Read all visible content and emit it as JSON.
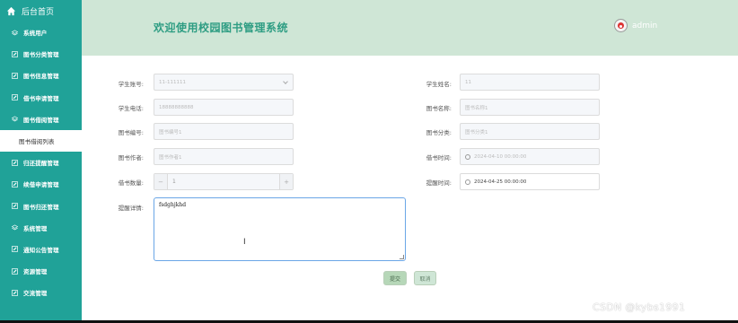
{
  "sidebar": {
    "home_label": "后台首页",
    "items": [
      {
        "label": "系统用户",
        "icon": "layers-icon"
      },
      {
        "label": "图书分类管理",
        "icon": "edit-icon"
      },
      {
        "label": "图书信息管理",
        "icon": "edit-icon"
      },
      {
        "label": "借书申请管理",
        "icon": "edit-icon"
      },
      {
        "label": "图书借阅管理",
        "icon": "layers-icon"
      },
      {
        "label": "图书借阅列表",
        "icon": ""
      },
      {
        "label": "归还提醒管理",
        "icon": "edit-icon"
      },
      {
        "label": "续借申请管理",
        "icon": "edit-icon"
      },
      {
        "label": "图书归还管理",
        "icon": "edit-icon"
      },
      {
        "label": "系统管理",
        "icon": "layers-icon"
      },
      {
        "label": "通知公告管理",
        "icon": "edit-icon"
      },
      {
        "label": "资源管理",
        "icon": "edit-icon"
      },
      {
        "label": "交流管理",
        "icon": "edit-icon"
      }
    ]
  },
  "header": {
    "title": "欢迎使用校园图书管理系统",
    "username": "admin"
  },
  "form": {
    "student_no_label": "学生账号:",
    "student_no_value": "11-111111",
    "student_name_label": "学生姓名:",
    "student_name_value": "11",
    "phone_label": "学生电话:",
    "phone_value": "18888888888",
    "book_name_label": "图书名称:",
    "book_name_placeholder": "图书名称1",
    "book_no_label": "图书编号:",
    "book_no_placeholder": "图书编号1",
    "book_category_label": "图书分类:",
    "book_category_placeholder": "图书分类1",
    "author_label": "图书作者:",
    "author_placeholder": "图书作者1",
    "borrow_time_label": "借书时间:",
    "borrow_time_value": "2024-04-10 00:00:00",
    "quantity_label": "借书数量:",
    "quantity_value": "1",
    "quantity_minus": "−",
    "quantity_plus": "+",
    "remind_time_label": "提醒时间:",
    "remind_time_value": "2024-04-25 00:00:00",
    "detail_label": "提醒详情:",
    "detail_value": "fsdghjkhd"
  },
  "buttons": {
    "submit": "提交",
    "cancel": "取消"
  },
  "watermark": "CSDN @kybs1991",
  "colors": {
    "sidebar": "#20a298",
    "header": "#cfe6d6",
    "title": "#2e9d83"
  }
}
